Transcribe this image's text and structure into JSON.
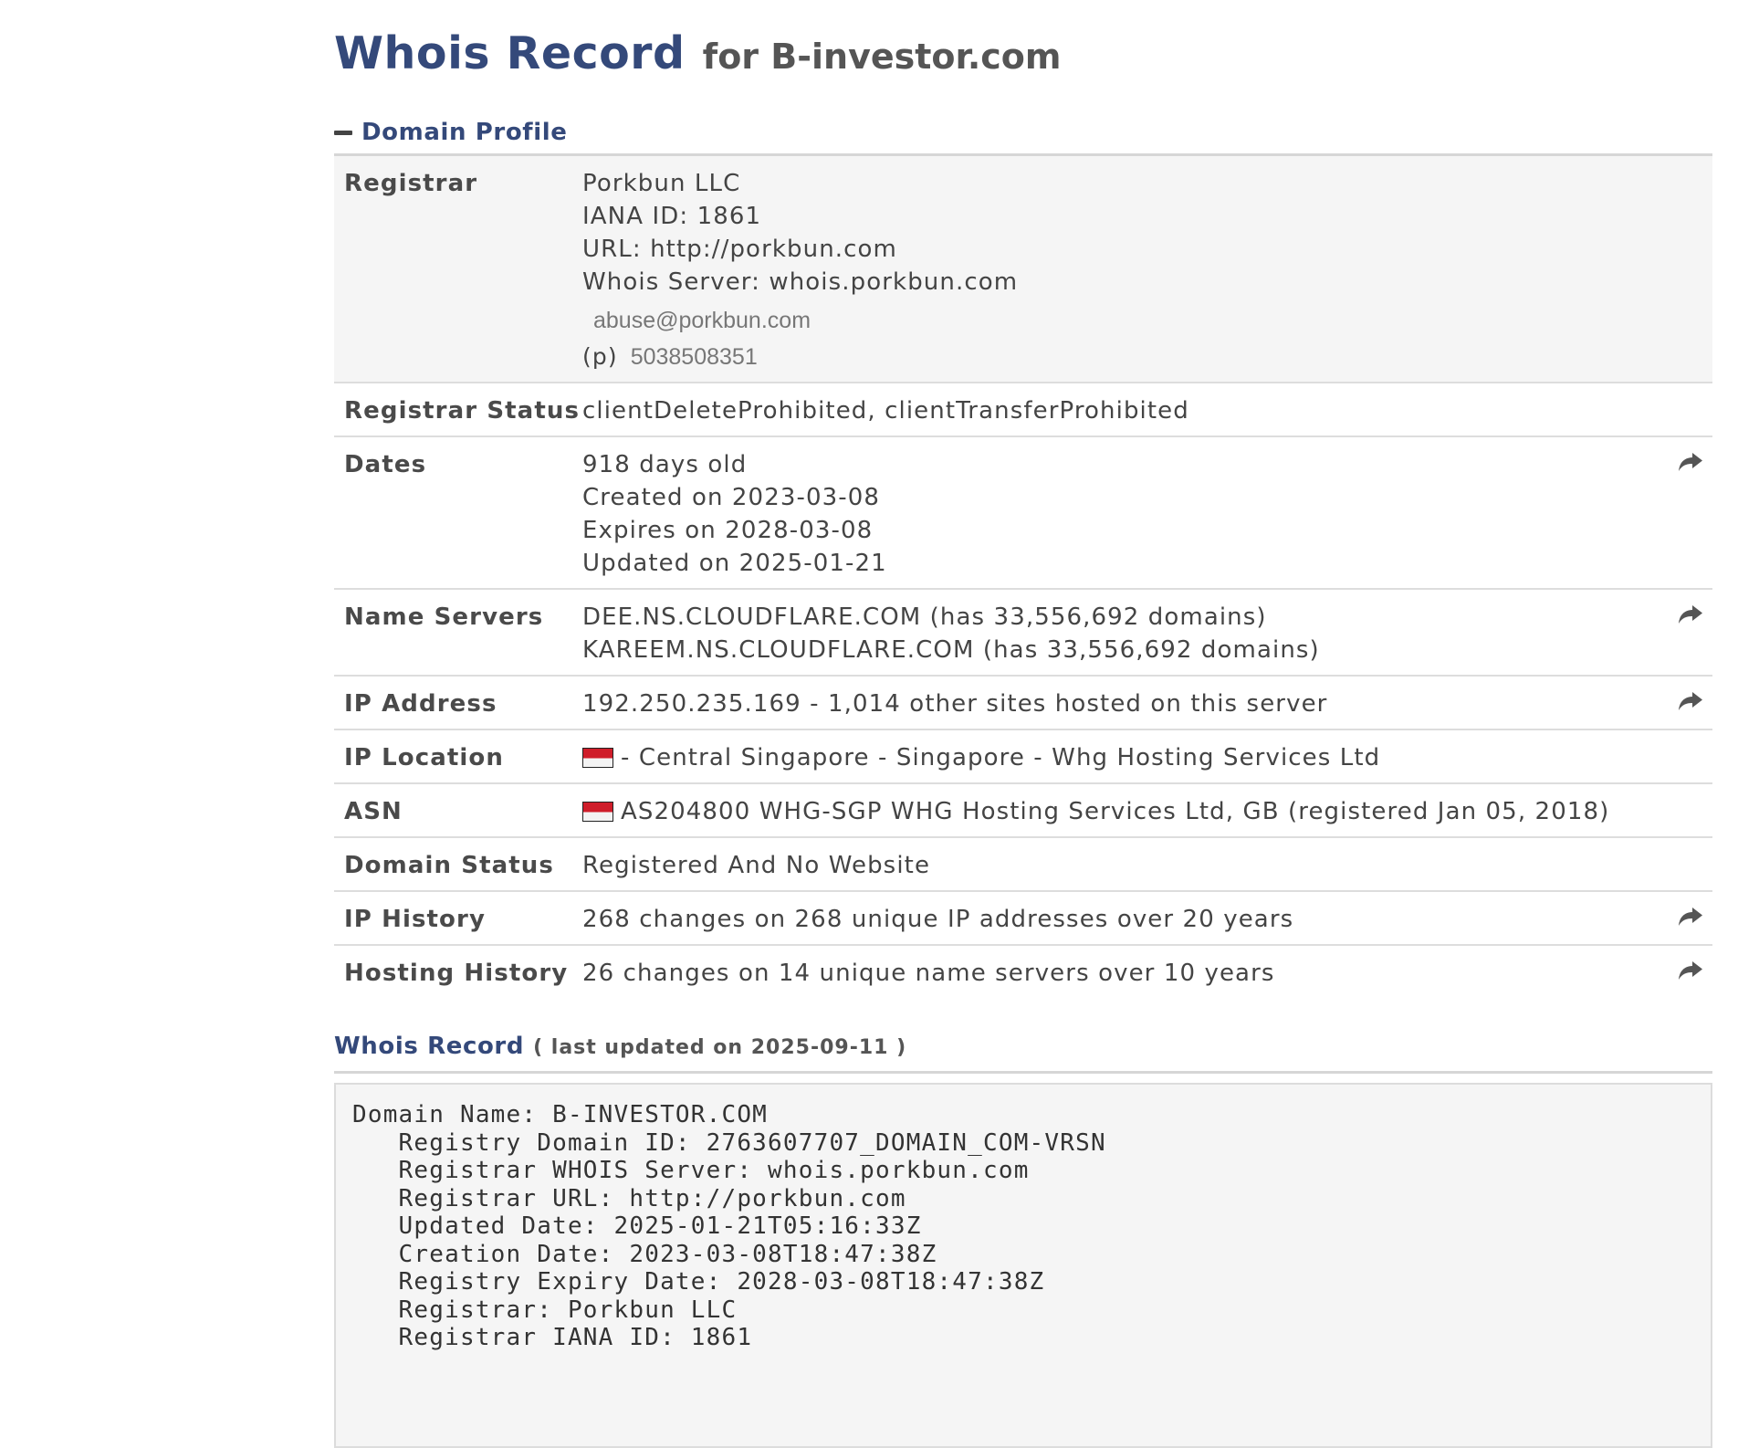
{
  "title": {
    "main": "Whois Record",
    "sub": "for B-investor.com"
  },
  "profile": {
    "header": "Domain Profile",
    "registrar": {
      "label": "Registrar",
      "name": "Porkbun LLC",
      "iana": "IANA ID: 1861",
      "url": "URL: http://porkbun.com",
      "whois_server": "Whois Server: whois.porkbun.com",
      "email": "abuse@porkbun.com",
      "phone_prefix": "(p)",
      "phone": "5038508351"
    },
    "registrar_status": {
      "label": "Registrar Status",
      "value": "clientDeleteProhibited, clientTransferProhibited"
    },
    "dates": {
      "label": "Dates",
      "age": "918 days old",
      "created": "Created on 2023-03-08",
      "expires": "Expires on 2028-03-08",
      "updated": "Updated on 2025-01-21"
    },
    "name_servers": {
      "label": "Name Servers",
      "values": [
        "DEE.NS.CLOUDFLARE.COM (has 33,556,692 domains)",
        "KAREEM.NS.CLOUDFLARE.COM (has 33,556,692 domains)"
      ]
    },
    "ip_address": {
      "label": "IP Address",
      "value": "192.250.235.169 - 1,014 other sites hosted on this server"
    },
    "ip_location": {
      "label": "IP Location",
      "value": "- Central Singapore - Singapore - Whg Hosting Services Ltd"
    },
    "asn": {
      "label": "ASN",
      "value": "AS204800 WHG-SGP WHG Hosting Services Ltd, GB (registered Jan 05, 2018)"
    },
    "domain_status": {
      "label": "Domain Status",
      "value": "Registered And No Website"
    },
    "ip_history": {
      "label": "IP History",
      "value": "268 changes on 268 unique IP addresses over 20 years"
    },
    "hosting_history": {
      "label": "Hosting History",
      "value": "26 changes on 14 unique name servers over 10 years"
    }
  },
  "whois_record": {
    "title": "Whois Record",
    "updated": "( last updated on 2025-09-11 )",
    "lines": [
      "Domain Name: B-INVESTOR.COM",
      "   Registry Domain ID: 2763607707_DOMAIN_COM-VRSN",
      "   Registrar WHOIS Server: whois.porkbun.com",
      "   Registrar URL: http://porkbun.com",
      "   Updated Date: 2025-01-21T05:16:33Z",
      "   Creation Date: 2023-03-08T18:47:38Z",
      "   Registry Expiry Date: 2028-03-08T18:47:38Z",
      "   Registrar: Porkbun LLC",
      "   Registrar IANA ID: 1861"
    ]
  },
  "icons": {
    "collapse": "minus-icon",
    "share": "share-arrow-icon",
    "flag": "singapore-flag-icon"
  },
  "colors": {
    "heading": "#34497a",
    "text": "#444444",
    "row_shade": "#f5f5f5",
    "divider": "#dddddd"
  }
}
